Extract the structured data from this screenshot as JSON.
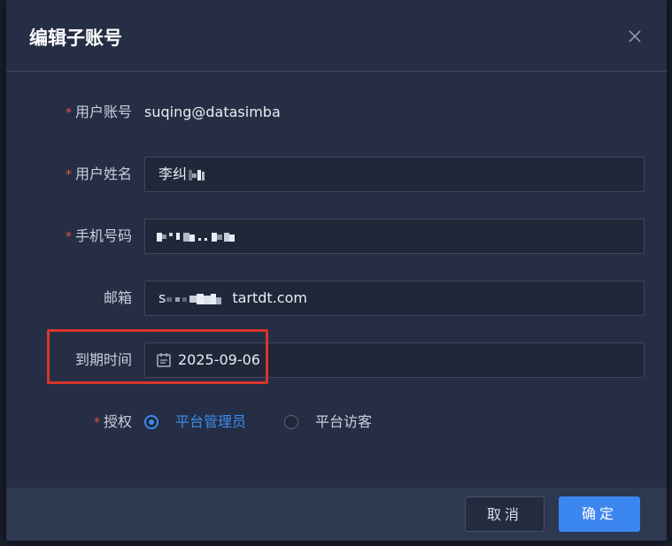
{
  "dialog": {
    "title": "编辑子账号",
    "close_icon": "close-icon"
  },
  "form": {
    "account": {
      "label": "用户账号",
      "required": true,
      "value": "suqing@datasimba"
    },
    "name": {
      "label": "用户姓名",
      "required": true,
      "value": "李纠"
    },
    "phone": {
      "label": "手机号码",
      "required": true,
      "value": ""
    },
    "email": {
      "label": "邮箱",
      "required": false,
      "value_prefix": "s",
      "value_suffix": "tartdt.com"
    },
    "expire": {
      "label": "到期时间",
      "required": false,
      "value": "2025-09-06",
      "icon": "calendar-icon"
    },
    "auth": {
      "label": "授权",
      "required": true,
      "options": [
        {
          "label": "平台管理员",
          "checked": true
        },
        {
          "label": "平台访客",
          "checked": false
        }
      ]
    }
  },
  "footer": {
    "cancel_label": "取消",
    "ok_label": "确定"
  },
  "colors": {
    "accent": "#3c86f0",
    "required": "#e5534b",
    "highlight": "#d9352c",
    "dialog_bg": "#252e44"
  }
}
